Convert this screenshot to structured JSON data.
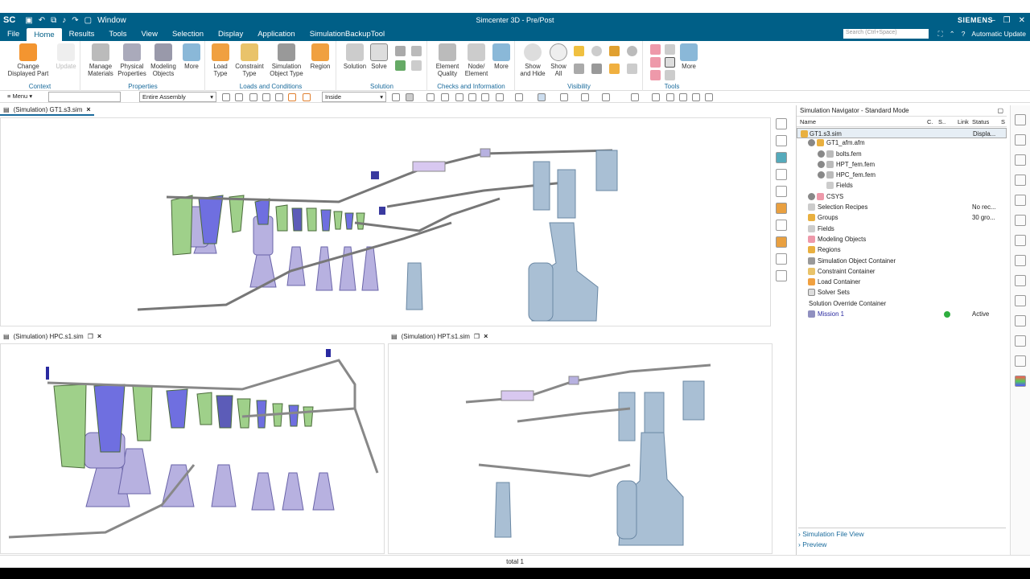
{
  "titlebar": {
    "logo": "SC",
    "window_menu": "Window",
    "title": "Simcenter 3D - Pre/Post",
    "brand": "SIEMENS"
  },
  "menu": {
    "items": [
      "File",
      "Home",
      "Results",
      "Tools",
      "View",
      "Selection",
      "Display",
      "Application",
      "SimulationBackupTool"
    ],
    "active": "Home",
    "search_placeholder": "Search (Ctrl+Space)",
    "auto_update": "Automatic Update"
  },
  "ribbon": {
    "context": {
      "label": "Context",
      "change": "Change\nDisplayed Part",
      "update": "Update"
    },
    "properties": {
      "label": "Properties",
      "manage": "Manage\nMaterials",
      "physical": "Physical\nProperties",
      "modeling": "Modeling\nObjects",
      "more": "More"
    },
    "loads": {
      "label": "Loads and Conditions",
      "load": "Load\nType",
      "constraint": "Constraint\nType",
      "simobj": "Simulation\nObject Type",
      "region": "Region"
    },
    "solution": {
      "label": "Solution",
      "solution": "Solution",
      "solve": "Solve"
    },
    "checks": {
      "label": "Checks and Information",
      "element": "Element\nQuality",
      "node": "Node/\nElement",
      "more": "More"
    },
    "visibility": {
      "label": "Visibility",
      "show_hide": "Show\nand Hide",
      "show_all": "Show\nAll"
    },
    "tools": {
      "label": "Tools",
      "more": "More"
    }
  },
  "toolbar2": {
    "menu": "Menu",
    "filter": "",
    "assembly": "Entire Assembly",
    "inside": "Inside"
  },
  "tabs": {
    "main": "(Simulation) GT1.s3.sim",
    "hpc": "(Simulation) HPC.s1.sim",
    "hpt": "(Simulation) HPT.s1.sim"
  },
  "navigator": {
    "title": "Simulation Navigator - Standard Mode",
    "columns": [
      "Name",
      "C.",
      "S..",
      "Link",
      "Status",
      "S"
    ],
    "rows": [
      {
        "name": "GT1.s3.sim",
        "status": "Displa..."
      },
      {
        "name": "GT1_afm.afm",
        "status": ""
      },
      {
        "name": "bolts.fem",
        "status": ""
      },
      {
        "name": "HPT_fem.fem",
        "status": ""
      },
      {
        "name": "HPC_fem.fem",
        "status": ""
      },
      {
        "name": "Fields",
        "status": ""
      },
      {
        "name": "CSYS",
        "status": ""
      },
      {
        "name": "Selection Recipes",
        "status": "No rec..."
      },
      {
        "name": "Groups",
        "status": "30 gro..."
      },
      {
        "name": "Fields",
        "status": ""
      },
      {
        "name": "Modeling Objects",
        "status": ""
      },
      {
        "name": "Regions",
        "status": ""
      },
      {
        "name": "Simulation Object Container",
        "status": ""
      },
      {
        "name": "Constraint Container",
        "status": ""
      },
      {
        "name": "Load Container",
        "status": ""
      },
      {
        "name": "Solver Sets",
        "status": ""
      },
      {
        "name": "Solution Override Container",
        "status": ""
      },
      {
        "name": "Mission 1",
        "status": "Active"
      }
    ],
    "file_view": "Simulation File View",
    "preview": "Preview"
  },
  "status": {
    "text": "total 1"
  },
  "colors": {
    "blade_green": "#9fd08a",
    "blade_blue": "#6f6fe0",
    "disk_purple": "#b7b1e0",
    "turbine_blue": "#a9bfd4",
    "accent": "#005f87"
  }
}
